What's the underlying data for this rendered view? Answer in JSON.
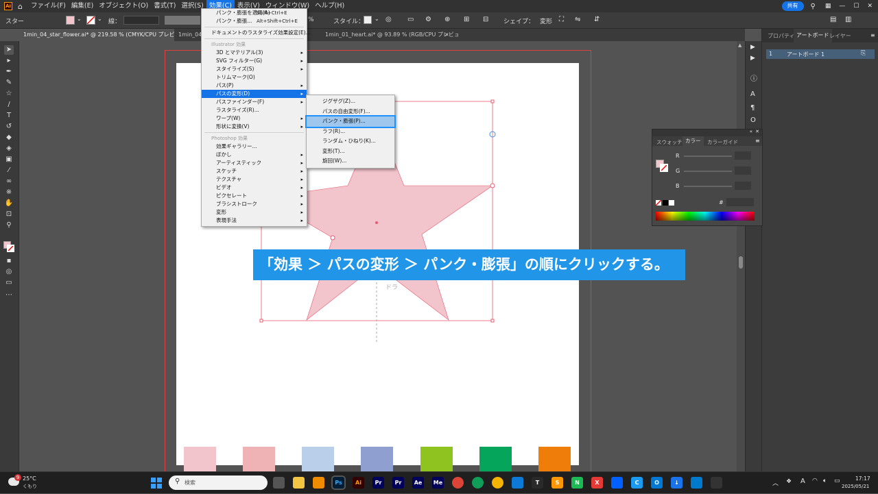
{
  "menubar": {
    "items": [
      "ファイル(F)",
      "編集(E)",
      "オブジェクト(O)",
      "書式(T)",
      "選択(S)",
      "効果(C)",
      "表示(V)",
      "ウィンドウ(W)",
      "ヘルプ(H)"
    ],
    "share_label": "共有"
  },
  "control": {
    "object_type": "スター",
    "stroke_label": "線：",
    "style_label": "スタイル：",
    "shape_label": "シェイプ：",
    "transform_label": "変形",
    "percent": "%"
  },
  "tabs": [
    "1min_04_star_flower.ai* @ 219.58 % (CMYK/CPU プレビュー)",
    "1min_04_...",
    "1min_01_heart.ai* @ 93.89 % (RGB/CPU プレビュー)"
  ],
  "effect_menu": {
    "top_items": [
      {
        "label": "パンク・膨張を適用(A)",
        "shortcut": "Shift+Ctrl+E"
      },
      {
        "label": "パンク・膨張...",
        "shortcut": "Alt+Shift+Ctrl+E"
      }
    ],
    "raster": "ドキュメントのラスタライズ効果設定(E)...",
    "illustrator_header": "Illustrator 効果",
    "illustrator_items": [
      {
        "label": "3D とマテリアル(3)",
        "arrow": true
      },
      {
        "label": "SVG フィルター(G)",
        "arrow": true
      },
      {
        "label": "スタイライズ(S)",
        "arrow": true
      },
      {
        "label": "トリムマーク(O)",
        "arrow": false
      },
      {
        "label": "パス(P)",
        "arrow": true
      },
      {
        "label": "パスの変形(D)",
        "arrow": true,
        "highlight": true
      },
      {
        "label": "パスファインダー(F)",
        "arrow": true
      },
      {
        "label": "ラスタライズ(R)...",
        "arrow": false
      },
      {
        "label": "ワープ(W)",
        "arrow": true
      },
      {
        "label": "形状に変換(V)",
        "arrow": true
      }
    ],
    "photoshop_header": "Photoshop 効果",
    "photoshop_items": [
      {
        "label": "効果ギャラリー...",
        "arrow": false
      },
      {
        "label": "ぼかし",
        "arrow": true
      },
      {
        "label": "アーティスティック",
        "arrow": true
      },
      {
        "label": "スケッチ",
        "arrow": true
      },
      {
        "label": "テクスチャ",
        "arrow": true
      },
      {
        "label": "ビデオ",
        "arrow": true
      },
      {
        "label": "ピクセレート",
        "arrow": true
      },
      {
        "label": "ブラシストローク",
        "arrow": true
      },
      {
        "label": "変形",
        "arrow": true
      },
      {
        "label": "表現手法",
        "arrow": true
      }
    ]
  },
  "submenu": {
    "items": [
      {
        "label": "ジグザグ(Z)..."
      },
      {
        "label": "パスの自由変形(F)..."
      },
      {
        "label": "パンク・膨張(P)...",
        "highlight": true
      },
      {
        "label": "ラフ(R)..."
      },
      {
        "label": "ランダム・ひねり(K)..."
      },
      {
        "label": "変形(T)..."
      },
      {
        "label": "旋回(W)..."
      }
    ]
  },
  "canvas": {
    "overlay_text": "ドラ",
    "swatch_colors": [
      "#f2c4cc",
      "#f0b3b5",
      "#b9cfea",
      "#8f9fcf",
      "#8fc31f",
      "#05a55c",
      "#ef7d0a"
    ],
    "star_color": "#f2c4cc",
    "bound_color": "#e85a6e"
  },
  "layers_panel": {
    "tabs": [
      "プロパティ",
      "アートボード",
      "レイヤー"
    ],
    "row_index": "1",
    "row_name": "アートボード 1"
  },
  "color_panel": {
    "tabs": [
      "スウォッチ",
      "カラー",
      "カラーガイド"
    ],
    "channels": [
      "R",
      "G",
      "B"
    ],
    "hash": "#"
  },
  "banner": {
    "text": "「効果 ＞ パスの変形 ＞ パンク・膨張」の順にクリックする。"
  },
  "taskbar": {
    "temperature": "25°C",
    "weather": "くもり",
    "search_placeholder": "検索",
    "time": "17:17",
    "date": "2025/05/21",
    "notification_count": "9",
    "apps": [
      {
        "icon": "task-view",
        "label": "",
        "color": "#555"
      },
      {
        "icon": "explorer",
        "label": "",
        "color": "#f4c542"
      },
      {
        "icon": "vlc",
        "label": "",
        "color": "#f08c00"
      },
      {
        "icon": "photoshop",
        "label": "Ps",
        "color": "#001e36"
      },
      {
        "icon": "illustrator",
        "label": "Ai",
        "color": "#330000"
      },
      {
        "icon": "premiere",
        "label": "Pr",
        "color": "#00005b"
      },
      {
        "icon": "premiere-2",
        "label": "Pr",
        "color": "#00005b"
      },
      {
        "icon": "after-effects",
        "label": "Ae",
        "color": "#00005b"
      },
      {
        "icon": "media-encoder",
        "label": "Me",
        "color": "#00005b"
      },
      {
        "icon": "chrome",
        "label": "",
        "color": "#db4437"
      },
      {
        "icon": "chrome-2",
        "label": "",
        "color": "#0f9d58"
      },
      {
        "icon": "chrome-3",
        "label": "",
        "color": "#f4b400"
      },
      {
        "icon": "edge",
        "label": "",
        "color": "#0c7ad6"
      },
      {
        "icon": "app-tp",
        "label": "T",
        "color": "#2a2a2a"
      },
      {
        "icon": "sublime",
        "label": "S",
        "color": "#ff9800"
      },
      {
        "icon": "app-n",
        "label": "N",
        "color": "#1db954"
      },
      {
        "icon": "app-x",
        "label": "X",
        "color": "#e53935"
      },
      {
        "icon": "dropbox",
        "label": "",
        "color": "#0061fe"
      },
      {
        "icon": "app-clip",
        "label": "C",
        "color": "#1a9af0"
      },
      {
        "icon": "outlook",
        "label": "O",
        "color": "#0078d4"
      },
      {
        "icon": "download",
        "label": "↓",
        "color": "#1a73e8"
      },
      {
        "icon": "vscode",
        "label": "",
        "color": "#007acc"
      },
      {
        "icon": "recorder",
        "label": "",
        "color": "#333"
      }
    ]
  }
}
